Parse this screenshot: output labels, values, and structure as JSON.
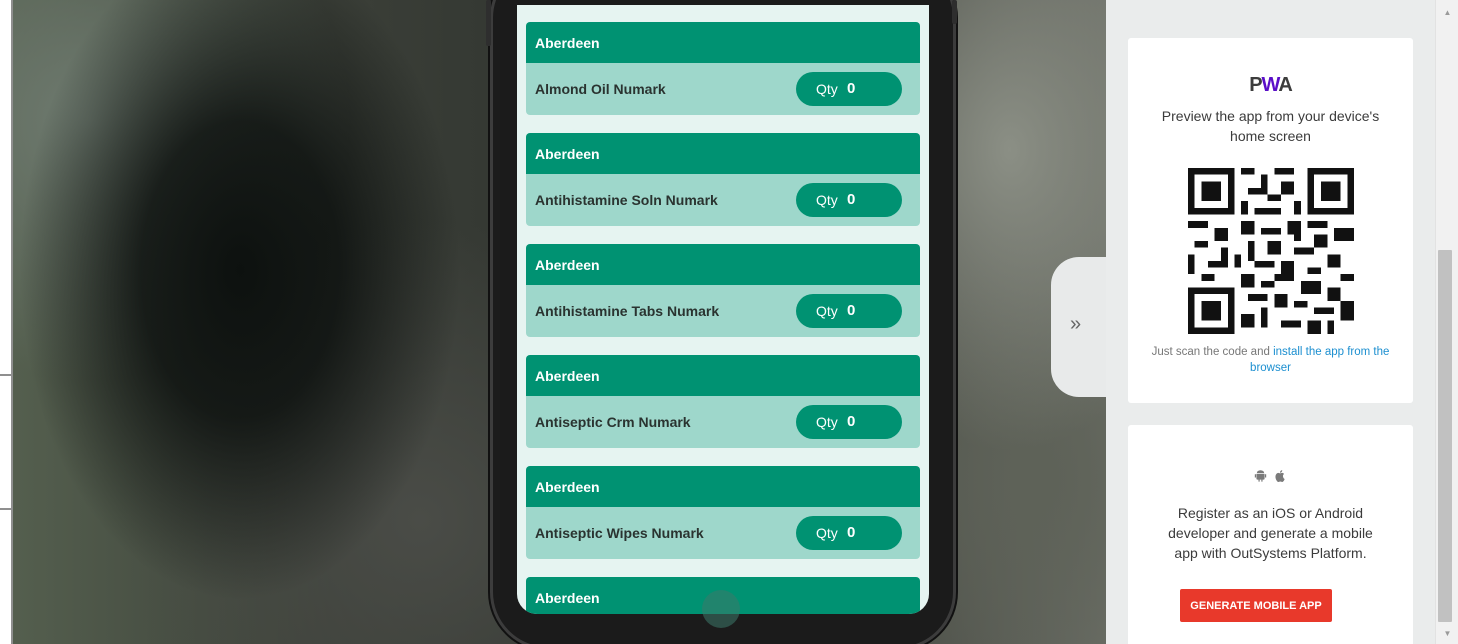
{
  "app": {
    "list_items": [
      {
        "location": "Aberdeen",
        "product": "Almond Oil Numark",
        "qty_label": "Qty",
        "qty": "0"
      },
      {
        "location": "Aberdeen",
        "product": "Antihistamine Soln Numark",
        "qty_label": "Qty",
        "qty": "0"
      },
      {
        "location": "Aberdeen",
        "product": "Antihistamine Tabs Numark",
        "qty_label": "Qty",
        "qty": "0"
      },
      {
        "location": "Aberdeen",
        "product": "Antiseptic Crm Numark",
        "qty_label": "Qty",
        "qty": "0"
      },
      {
        "location": "Aberdeen",
        "product": "Antiseptic Wipes Numark",
        "qty_label": "Qty",
        "qty": "0"
      },
      {
        "location": "Aberdeen"
      }
    ]
  },
  "panel": {
    "collapse_icon": "double-chevron-right",
    "pwa": {
      "logo_p": "P",
      "logo_w": "W",
      "logo_a": "A",
      "title": "Preview the app from your device's home screen",
      "scan_prefix": "Just scan the code and ",
      "scan_link": "install the app from the browser"
    },
    "native": {
      "icons": [
        "android-icon",
        "apple-icon"
      ],
      "text": "Register as an iOS or Android developer and generate a mobile app with OutSystems Platform.",
      "button": "GENERATE MOBILE APP"
    }
  },
  "colors": {
    "accent": "#009272",
    "row_bg": "#9ed7cb",
    "screen_bg": "#e6f4f1",
    "generate_button": "#e8392b",
    "link": "#1c8fd0",
    "pwa_purple": "#5a0fc8"
  }
}
